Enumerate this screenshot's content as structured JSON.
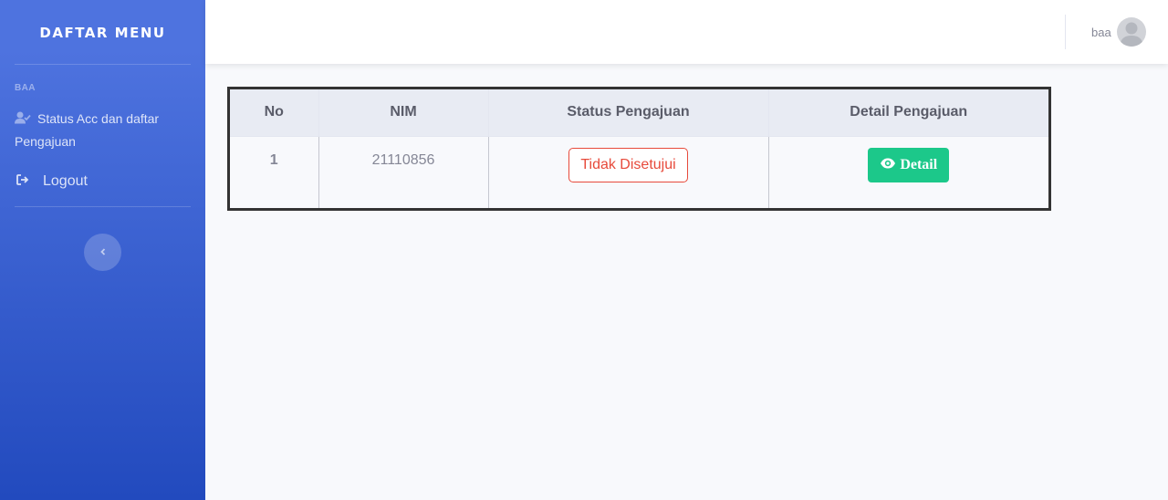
{
  "sidebar": {
    "brand": "DAFTAR MENU",
    "heading": "BAA",
    "items": [
      {
        "label": "Status Acc dan daftar Pengajuan",
        "icon": "user-check-icon"
      },
      {
        "label": "Logout",
        "icon": "sign-out-icon"
      }
    ],
    "toggle_icon": "chevron-left-icon"
  },
  "topbar": {
    "user_name": "baa",
    "avatar_icon": "user-avatar-icon"
  },
  "table": {
    "headers": [
      "No",
      "NIM",
      "Status Pengajuan",
      "Detail Pengajuan"
    ],
    "rows": [
      {
        "no": "1",
        "nim": "21110856",
        "status": "Tidak Disetujui",
        "detail_label": "Detail"
      }
    ]
  },
  "colors": {
    "sidebar_top": "#4e73df",
    "sidebar_bottom": "#224abe",
    "status_rejected": "#e74a3b",
    "detail_button": "#1cc88a"
  }
}
